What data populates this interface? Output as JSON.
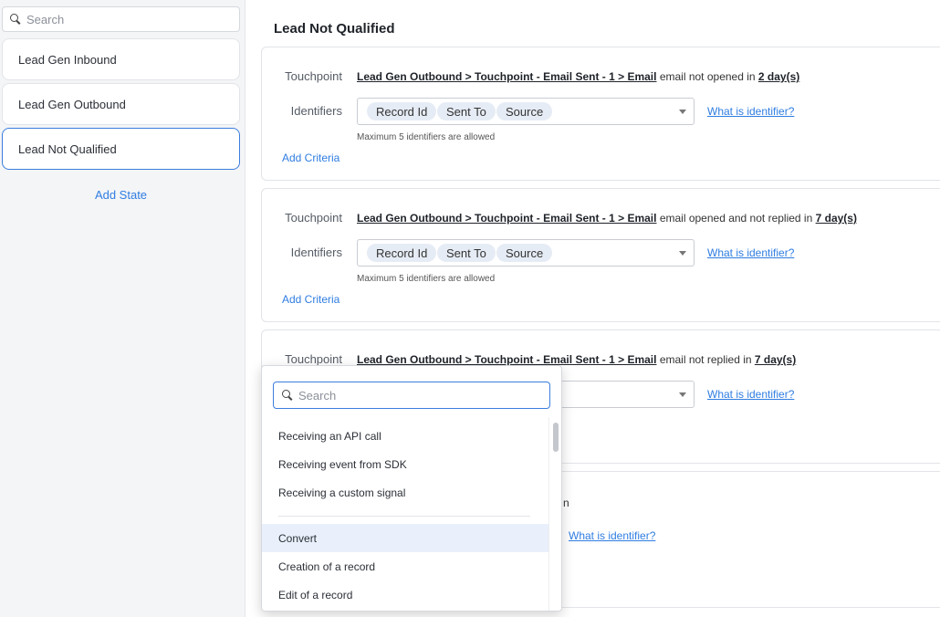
{
  "sidebar": {
    "search_placeholder": "Search",
    "states": [
      {
        "label": "Lead Gen Inbound"
      },
      {
        "label": "Lead Gen Outbound"
      },
      {
        "label": "Lead Not Qualified"
      }
    ],
    "add_state": "Add State"
  },
  "main": {
    "title": "Lead Not Qualified",
    "labels": {
      "touchpoint": "Touchpoint",
      "identifiers": "Identifiers",
      "hint": "Maximum 5 identifiers are allowed",
      "add_criteria": "Add Criteria",
      "what_is_identifier": "What is identifier?"
    },
    "chips": [
      "Record Id",
      "Sent To",
      "Source"
    ],
    "cards": [
      {
        "link": "Lead Gen Outbound > Touchpoint - Email Sent - 1 > Email",
        "text": " email not opened in ",
        "days": "2 day(s)"
      },
      {
        "link": "Lead Gen Outbound > Touchpoint - Email Sent - 1 > Email",
        "text": " email opened and not replied in ",
        "days": "7 day(s)"
      },
      {
        "link": "Lead Gen Outbound > Touchpoint - Email Sent - 1 > Email",
        "text": " email not replied in ",
        "days": "7 day(s)"
      }
    ],
    "card4_partial_text": "n"
  },
  "dropdown": {
    "search_placeholder": "Search",
    "items": [
      {
        "label": "Receiving an API call"
      },
      {
        "label": "Receiving event from SDK"
      },
      {
        "label": "Receiving a custom signal"
      },
      {
        "label": "Convert"
      },
      {
        "label": "Creation of a record"
      },
      {
        "label": "Edit of a record"
      }
    ],
    "highlighted_index": 3
  },
  "colors": {
    "accent": "#2f7de1",
    "active_border": "#3b7ddd",
    "chip_bg": "#e6ecf5",
    "highlight_bg": "#e9f0fb"
  }
}
